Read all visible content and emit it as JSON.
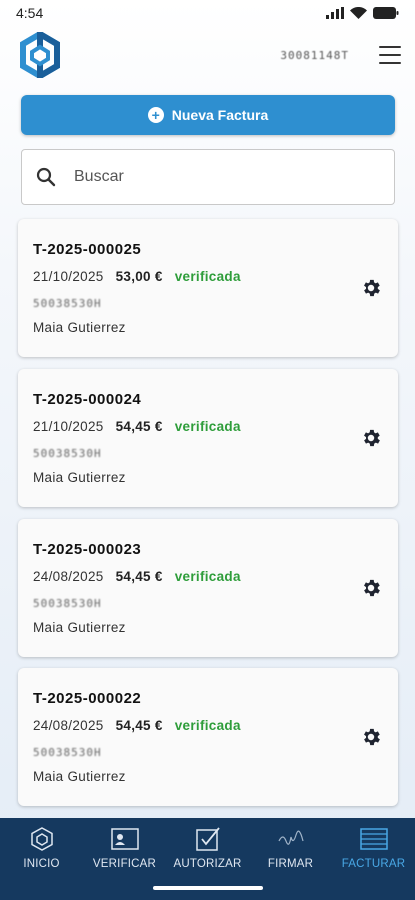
{
  "status_bar": {
    "time": "4:54"
  },
  "header": {
    "user_id": "30081148T"
  },
  "new_invoice": {
    "label": "Nueva Factura"
  },
  "search": {
    "placeholder": "Buscar"
  },
  "invoices": [
    {
      "number": "T-2025-000025",
      "date": "21/10/2025",
      "amount": "53,00 €",
      "status": "verificada",
      "nif": "50038530H",
      "client": "Maia Gutierrez"
    },
    {
      "number": "T-2025-000024",
      "date": "21/10/2025",
      "amount": "54,45 €",
      "status": "verificada",
      "nif": "50038530H",
      "client": "Maia Gutierrez"
    },
    {
      "number": "T-2025-000023",
      "date": "24/08/2025",
      "amount": "54,45 €",
      "status": "verificada",
      "nif": "50038530H",
      "client": "Maia Gutierrez"
    },
    {
      "number": "T-2025-000022",
      "date": "24/08/2025",
      "amount": "54,45 €",
      "status": "verificada",
      "nif": "50038530H",
      "client": "Maia Gutierrez"
    }
  ],
  "tabs": [
    {
      "label": "INICIO",
      "icon": "home-hexagon-icon"
    },
    {
      "label": "VERIFICAR",
      "icon": "id-card-icon"
    },
    {
      "label": "AUTORIZAR",
      "icon": "checkbox-icon"
    },
    {
      "label": "FIRMAR",
      "icon": "signature-icon"
    },
    {
      "label": "FACTURAR",
      "icon": "invoice-list-icon",
      "active": true
    }
  ],
  "colors": {
    "brand": "#2e8fd0",
    "tab_bar": "#15395f",
    "active_tab": "#49a8e6",
    "status_ok": "#2e9d3a"
  }
}
